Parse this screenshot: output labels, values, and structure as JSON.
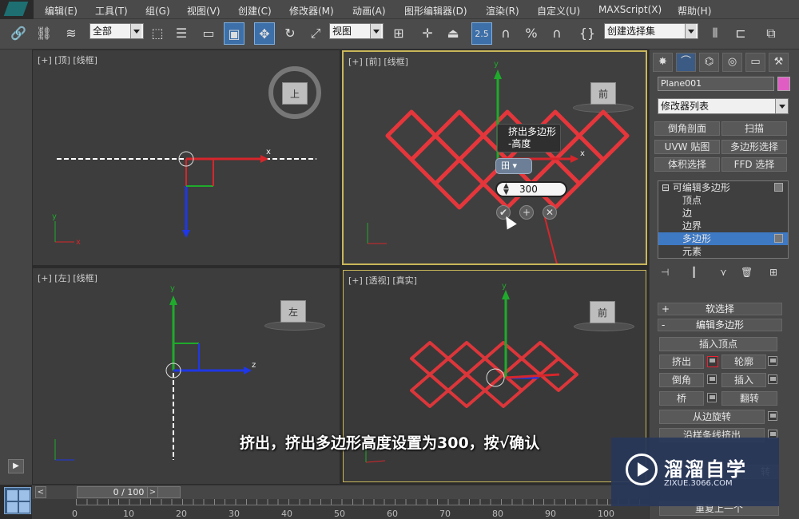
{
  "menu": [
    "编辑(E)",
    "工具(T)",
    "组(G)",
    "视图(V)",
    "创建(C)",
    "修改器(M)",
    "动画(A)",
    "图形编辑器(D)",
    "渲染(R)",
    "自定义(U)",
    "MAXScript(X)",
    "帮助(H)"
  ],
  "toolbar": {
    "filter": "全部",
    "ref_coord": "视图",
    "spinner_snap": "2.5",
    "named_selection": "创建选择集"
  },
  "viewports": {
    "top": {
      "label": "[+] [顶] [线框]",
      "cube": "上"
    },
    "front": {
      "label": "[+] [前] [线框]",
      "cube": "前"
    },
    "left": {
      "label": "[+] [左] [线框]",
      "cube": "左"
    },
    "persp": {
      "label": "[+] [透视] [真实]",
      "cube": "前"
    }
  },
  "axis": {
    "x": "x",
    "y": "y",
    "z": "z"
  },
  "caddy": {
    "title_line1": "挤出多边形",
    "title_line2": "-高度",
    "mode": "田 ▾",
    "value": "300"
  },
  "command_panel": {
    "object_name": "Plane001",
    "object_color": "#e05ec4",
    "modifier_list": "修改器列表",
    "buttons": [
      "倒角剖面",
      "扫描",
      "UVW 贴图",
      "多边形选择",
      "体积选择",
      "FFD 选择"
    ],
    "stack": {
      "root": "可编辑多边形",
      "items": [
        "顶点",
        "边",
        "边界",
        "多边形",
        "元素"
      ],
      "selected": "多边形"
    },
    "rollouts": {
      "soft": "软选择",
      "edit": "编辑多边形"
    },
    "edit_poly": {
      "insert_vertex": "插入顶点",
      "extrude": "挤出",
      "outline": "轮廓",
      "bevel": "倒角",
      "inset": "插入",
      "bridge": "桥",
      "flip": "翻转",
      "hinge": "从边旋转",
      "extrude_spline": "沿样条线挤出",
      "partial": "转",
      "retri": "重复上一个"
    }
  },
  "timeline": {
    "frame": "0 / 100",
    "ticks": [
      "0",
      "10",
      "20",
      "30",
      "40",
      "50",
      "60",
      "70",
      "80",
      "90",
      "100"
    ]
  },
  "subtitle": "挤出，挤出多边形高度设置为300，按√确认",
  "watermark": {
    "title": "溜溜自学",
    "url": "ZIXUE.3066.COM"
  }
}
